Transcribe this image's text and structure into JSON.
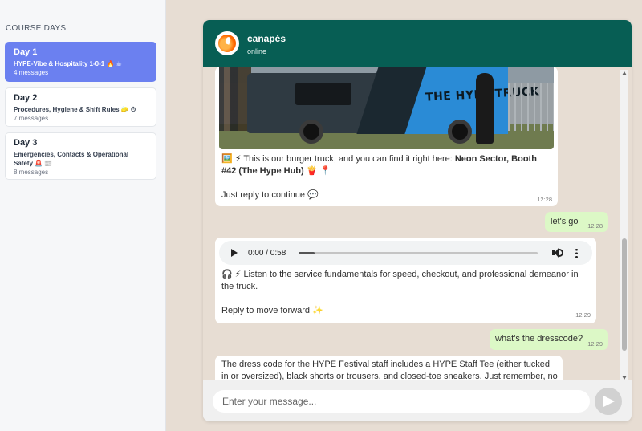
{
  "sidebar": {
    "title": "COURSE DAYS",
    "days": [
      {
        "title": "Day 1",
        "subtitle": "HYPE-Vibe & Hospitality 1-0-1 🔥 ☕",
        "count": "4 messages"
      },
      {
        "title": "Day 2",
        "subtitle": "Procedures, Hygiene & Shift Rules 🧽 ⏱",
        "count": "7 messages"
      },
      {
        "title": "Day 3",
        "subtitle": "Emergencies, Contacts & Operational Safety 🚨 📰",
        "count": "8 messages"
      }
    ]
  },
  "chat": {
    "name": "canapés",
    "status": "online",
    "messages": [
      {
        "image_text": "THE HYPE TRUCK",
        "text_prefix": "🖼️ ⚡ This is our burger truck, and you can find it right here: ",
        "text_bold": "Neon Sector, Booth #42 (The Hype Hub)",
        "text_suffix": " 🍟 📍",
        "text2": "Just reply to continue 💬",
        "time": "12:28"
      },
      {
        "text": "let's go",
        "time": "12:28"
      },
      {
        "audio_time": "0:00 / 0:58",
        "text": "🎧 ⚡ Listen to the service fundamentals for speed, checkout, and professional demeanor in the truck.",
        "text2": "Reply to move forward ✨",
        "time": "12:29"
      },
      {
        "text": "what's the dresscode?",
        "time": "12:29"
      },
      {
        "text": "The dress code for the HYPE Festival staff includes a HYPE Staff Tee (either tucked in or oversized), black shorts or trousers, and closed-toe sneakers. Just remember, no sandals"
      }
    ]
  },
  "composer": {
    "placeholder": "Enter your message..."
  },
  "colors": {
    "header": "#075e54",
    "active_day": "#6b80f0",
    "outgoing_bubble": "#dcf8c6"
  }
}
